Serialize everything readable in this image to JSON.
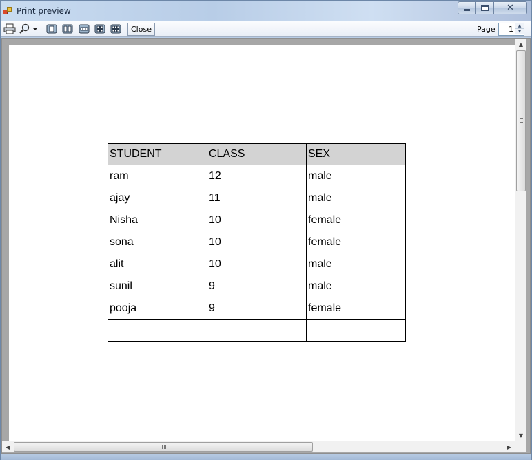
{
  "window": {
    "title": "Print preview"
  },
  "toolbar": {
    "print_icon": "printer-icon",
    "zoom_icon": "magnifier-icon",
    "zoom_dropdown_icon": "chevron-down-icon",
    "page_layout_icons": [
      "one-page-icon",
      "two-pages-icon",
      "three-pages-icon",
      "four-pages-icon",
      "six-pages-icon"
    ],
    "close_label": "Close",
    "page_label": "Page",
    "page_value": "1"
  },
  "table": {
    "headers": [
      "STUDENT",
      "CLASS",
      "SEX"
    ],
    "rows": [
      [
        "ram",
        "12",
        "male"
      ],
      [
        "ajay",
        "11",
        "male"
      ],
      [
        "Nisha",
        "10",
        "female"
      ],
      [
        "sona",
        "10",
        "female"
      ],
      [
        "alit",
        "10",
        "male"
      ],
      [
        "sunil",
        "9",
        "male"
      ],
      [
        "pooja",
        "9",
        "female"
      ],
      [
        "",
        "",
        ""
      ]
    ],
    "header_bg": "#d3d3d3"
  },
  "colors": {
    "preview_background": "#a7a7a7",
    "paper": "#ffffff",
    "titlebar": "#c6d9ee"
  }
}
